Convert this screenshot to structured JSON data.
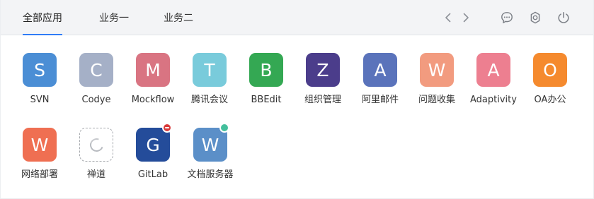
{
  "topbar": {
    "tabs": [
      {
        "label": "全部应用",
        "active": true
      },
      {
        "label": "业务一",
        "active": false
      },
      {
        "label": "业务二",
        "active": false
      }
    ],
    "icons": {
      "prev": "chevron-left-icon",
      "next": "chevron-right-icon",
      "message": "message-icon",
      "settings": "gear-icon",
      "power": "power-icon"
    },
    "accent_color": "#2f7cf6"
  },
  "apps": [
    {
      "letter": "S",
      "label": "SVN",
      "color": "#4b8ed5"
    },
    {
      "letter": "C",
      "label": "Codye",
      "color": "#a5b0c7"
    },
    {
      "letter": "M",
      "label": "Mockflow",
      "color": "#d97482"
    },
    {
      "letter": "T",
      "label": "腾讯会议",
      "color": "#79cbdb"
    },
    {
      "letter": "B",
      "label": "BBEdit",
      "color": "#34a853"
    },
    {
      "letter": "Z",
      "label": "组织管理",
      "color": "#4b3d8b"
    },
    {
      "letter": "A",
      "label": "阿里邮件",
      "color": "#5a73bb"
    },
    {
      "letter": "W",
      "label": "问题收集",
      "color": "#f29b7f"
    },
    {
      "letter": "A",
      "label": "Adaptivity",
      "color": "#ed7f90"
    },
    {
      "letter": "O",
      "label": "OA办公",
      "color": "#f58a2e"
    },
    {
      "letter": "W",
      "label": "网络部署",
      "color": "#ef6f52"
    },
    {
      "letter": "",
      "label": "禅道",
      "color": "#ffffff",
      "loading": true
    },
    {
      "letter": "G",
      "label": "GitLab",
      "color": "#244c9a",
      "badge": "red",
      "badge_color": "#d93a3a"
    },
    {
      "letter": "W",
      "label": "文档服务器",
      "color": "#5b8fc8",
      "badge": "green",
      "badge_color": "#43bf9c"
    }
  ]
}
